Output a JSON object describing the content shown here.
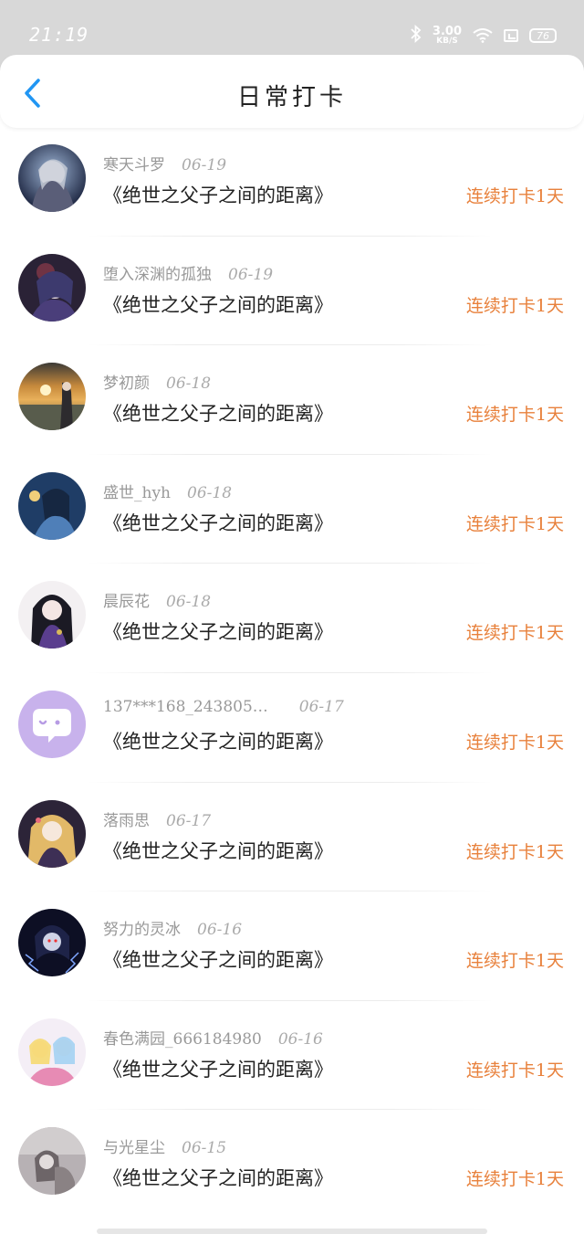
{
  "status_bar": {
    "time": "21:19",
    "net_speed_value": "3.00",
    "net_speed_unit": "KB/S",
    "battery": "76"
  },
  "header": {
    "title": "日常打卡",
    "back_icon": "chevron-left-icon"
  },
  "colors": {
    "accent": "#2196f3",
    "streak": "#e8813c",
    "meta": "#999999"
  },
  "entries": [
    {
      "user": "寒天斗罗",
      "date": "06-19",
      "book": "《绝世之父子之间的距离》",
      "streak": "连续打卡1天",
      "avatar": "avatar-anime-silver"
    },
    {
      "user": "堕入深渊的孤独",
      "date": "06-19",
      "book": "《绝世之父子之间的距离》",
      "streak": "连续打卡1天",
      "avatar": "avatar-anime-dark"
    },
    {
      "user": "梦初颜",
      "date": "06-18",
      "book": "《绝世之父子之间的距离》",
      "streak": "连续打卡1天",
      "avatar": "avatar-sunset"
    },
    {
      "user": "盛世_hyh",
      "date": "06-18",
      "book": "《绝世之父子之间的距离》",
      "streak": "连续打卡1天",
      "avatar": "avatar-anime-blue"
    },
    {
      "user": "晨辰花",
      "date": "06-18",
      "book": "《绝世之父子之间的距离》",
      "streak": "连续打卡1天",
      "avatar": "avatar-anime-girl"
    },
    {
      "user": "137***168_243805…",
      "date": "06-17",
      "book": "《绝世之父子之间的距离》",
      "streak": "连续打卡1天",
      "avatar": "avatar-default-chat"
    },
    {
      "user": "落雨思",
      "date": "06-17",
      "book": "《绝世之父子之间的距离》",
      "streak": "连续打卡1天",
      "avatar": "avatar-anime-gold"
    },
    {
      "user": "努力的灵冰",
      "date": "06-16",
      "book": "《绝世之父子之间的距离》",
      "streak": "连续打卡1天",
      "avatar": "avatar-anime-lightning"
    },
    {
      "user": "春色满园_666184980",
      "date": "06-16",
      "book": "《绝世之父子之间的距离》",
      "streak": "连续打卡1天",
      "avatar": "avatar-anime-colorful"
    },
    {
      "user": "与光星尘",
      "date": "06-15",
      "book": "《绝世之父子之间的距离》",
      "streak": "连续打卡1天",
      "avatar": "avatar-sketch"
    }
  ]
}
